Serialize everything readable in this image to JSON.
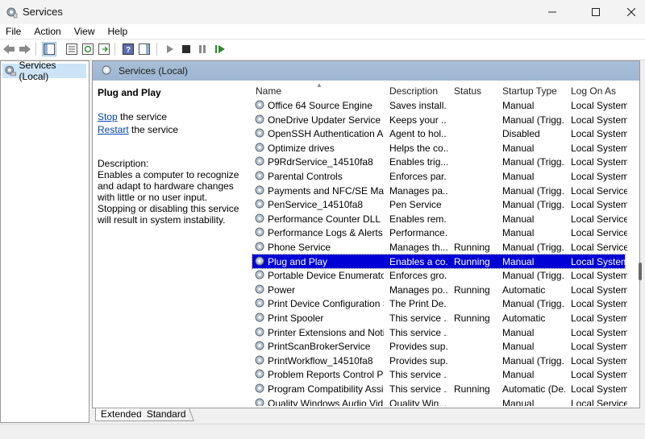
{
  "window": {
    "title": "Services"
  },
  "menu": [
    "File",
    "Action",
    "View",
    "Help"
  ],
  "tree": {
    "root_label": "Services (Local)"
  },
  "main_header": {
    "label": "Services (Local)"
  },
  "description_pane": {
    "service_name": "Plug and Play",
    "stop_link": "Stop",
    "stop_suffix": " the service",
    "restart_link": "Restart",
    "restart_suffix": " the service",
    "description_label": "Description:",
    "description_text": "Enables a computer to recognize and adapt to hardware changes with little or no user input. Stopping or disabling this service will result in system instability."
  },
  "columns": [
    "Name",
    "Description",
    "Status",
    "Startup Type",
    "Log On As"
  ],
  "services": [
    {
      "name": "Office 64 Source Engine",
      "description": "Saves install...",
      "status": "",
      "startup": "Manual",
      "logon": "Local System"
    },
    {
      "name": "OneDrive Updater Service",
      "description": "Keeps your ...",
      "status": "",
      "startup": "Manual (Trigg...",
      "logon": "Local System"
    },
    {
      "name": "OpenSSH Authentication Ag...",
      "description": "Agent to hol...",
      "status": "",
      "startup": "Disabled",
      "logon": "Local System"
    },
    {
      "name": "Optimize drives",
      "description": "Helps the co...",
      "status": "",
      "startup": "Manual",
      "logon": "Local System"
    },
    {
      "name": "P9RdrService_14510fa8",
      "description": "Enables trig...",
      "status": "",
      "startup": "Manual (Trigg...",
      "logon": "Local System"
    },
    {
      "name": "Parental Controls",
      "description": "Enforces par...",
      "status": "",
      "startup": "Manual",
      "logon": "Local System"
    },
    {
      "name": "Payments and NFC/SE Mana...",
      "description": "Manages pa...",
      "status": "",
      "startup": "Manual (Trigg...",
      "logon": "Local Service"
    },
    {
      "name": "PenService_14510fa8",
      "description": "Pen Service",
      "status": "",
      "startup": "Manual (Trigg...",
      "logon": "Local System"
    },
    {
      "name": "Performance Counter DLL H...",
      "description": "Enables rem...",
      "status": "",
      "startup": "Manual",
      "logon": "Local Service"
    },
    {
      "name": "Performance Logs & Alerts",
      "description": "Performance...",
      "status": "",
      "startup": "Manual",
      "logon": "Local Service"
    },
    {
      "name": "Phone Service",
      "description": "Manages th...",
      "status": "Running",
      "startup": "Manual (Trigg...",
      "logon": "Local Service"
    },
    {
      "name": "Plug and Play",
      "description": "Enables a co...",
      "status": "Running",
      "startup": "Manual",
      "logon": "Local System",
      "selected": true
    },
    {
      "name": "Portable Device Enumerator ...",
      "description": "Enforces gro...",
      "status": "",
      "startup": "Manual (Trigg...",
      "logon": "Local System"
    },
    {
      "name": "Power",
      "description": "Manages po...",
      "status": "Running",
      "startup": "Automatic",
      "logon": "Local System"
    },
    {
      "name": "Print Device Configuration S...",
      "description": "The Print De...",
      "status": "",
      "startup": "Manual (Trigg...",
      "logon": "Local System"
    },
    {
      "name": "Print Spooler",
      "description": "This service ...",
      "status": "Running",
      "startup": "Automatic",
      "logon": "Local System"
    },
    {
      "name": "Printer Extensions and Notifi...",
      "description": "This service ...",
      "status": "",
      "startup": "Manual",
      "logon": "Local System"
    },
    {
      "name": "PrintScanBrokerService",
      "description": "Provides sup...",
      "status": "",
      "startup": "Manual",
      "logon": "Local System"
    },
    {
      "name": "PrintWorkflow_14510fa8",
      "description": "Provides sup...",
      "status": "",
      "startup": "Manual (Trigg...",
      "logon": "Local System"
    },
    {
      "name": "Problem Reports Control Pa...",
      "description": "This service ...",
      "status": "",
      "startup": "Manual",
      "logon": "Local System"
    },
    {
      "name": "Program Compatibility Assis...",
      "description": "This service ...",
      "status": "Running",
      "startup": "Automatic (De...",
      "logon": "Local System"
    },
    {
      "name": "Quality Windows Audio Vid...",
      "description": "Quality Win...",
      "status": "",
      "startup": "Manual",
      "logon": "Local Service"
    }
  ],
  "tabs": [
    "Extended",
    "Standard"
  ],
  "colors": {
    "selection": "#0000d6",
    "header_band": "#a9bfd8",
    "link": "#0645ad",
    "tree_selected": "#cde4f7"
  }
}
